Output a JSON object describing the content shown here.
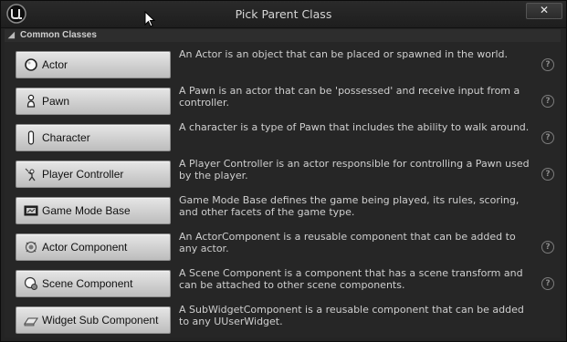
{
  "window": {
    "title": "Pick Parent Class",
    "close_label": "✕"
  },
  "section": {
    "header": "Common Classes"
  },
  "classes": [
    {
      "label": "Actor",
      "icon": "actor-icon",
      "description": "An Actor is an object that can be placed or spawned in the world.",
      "help": "?"
    },
    {
      "label": "Pawn",
      "icon": "pawn-icon",
      "description": "A Pawn is an actor that can be 'possessed' and receive input from a controller.",
      "help": "?"
    },
    {
      "label": "Character",
      "icon": "character-icon",
      "description": "A character is a type of Pawn that includes the ability to walk around.",
      "help": "?"
    },
    {
      "label": "Player Controller",
      "icon": "player-controller-icon",
      "description": "A Player Controller is an actor responsible for controlling a Pawn used by the player.",
      "help": "?"
    },
    {
      "label": "Game Mode Base",
      "icon": "game-mode-icon",
      "description": "Game Mode Base defines the game being played, its rules, scoring, and other facets of the game type.",
      "help": ""
    },
    {
      "label": "Actor Component",
      "icon": "actor-component-icon",
      "description": "An ActorComponent is a reusable component that can be added to any actor.",
      "help": "?"
    },
    {
      "label": "Scene Component",
      "icon": "scene-component-icon",
      "description": "A Scene Component is a component that has a scene transform and can be attached to other scene components.",
      "help": "?"
    },
    {
      "label": "Widget Sub Component",
      "icon": "widget-sub-component-icon",
      "description": "A SubWidgetComponent is a reusable component that can be added to any UUserWidget.",
      "help": ""
    }
  ],
  "colors": {
    "background": "#242424",
    "button_face": "#d4d4d4",
    "text": "#cfcfcf"
  }
}
